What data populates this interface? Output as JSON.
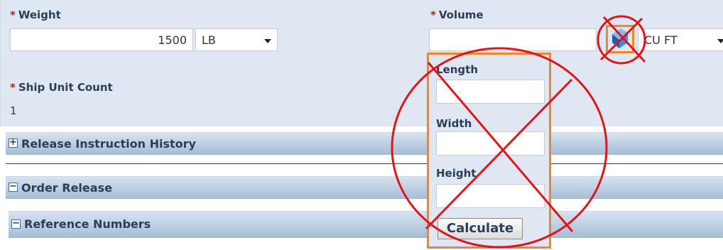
{
  "weight": {
    "label": "Weight",
    "required_mark": "*",
    "value": "1500",
    "unit": "LB"
  },
  "volume": {
    "label": "Volume",
    "required_mark": "*",
    "value": "",
    "unit": "CU FT",
    "calculator_icon": "calculator-icon"
  },
  "ship_unit_count": {
    "label": "Ship Unit Count",
    "required_mark": "*",
    "value": "1"
  },
  "sections": {
    "release_instruction_history": {
      "title": "Release Instruction History",
      "state": "collapsed",
      "icon": "expand-icon"
    },
    "order_release": {
      "title": "Order Release",
      "state": "expanded",
      "icon": "collapse-icon"
    },
    "reference_numbers": {
      "title": "Reference Numbers",
      "state": "expanded",
      "icon": "collapse-icon"
    }
  },
  "volume_calculator": {
    "length_label": "Length",
    "width_label": "Width",
    "height_label": "Height",
    "calculate_button": "Calculate"
  },
  "colors": {
    "panel": "#dfe8f2",
    "label": "#2b3e55",
    "required": "#e01010",
    "highlight_box": "#f0862a",
    "cross_out": "#e0151b"
  }
}
